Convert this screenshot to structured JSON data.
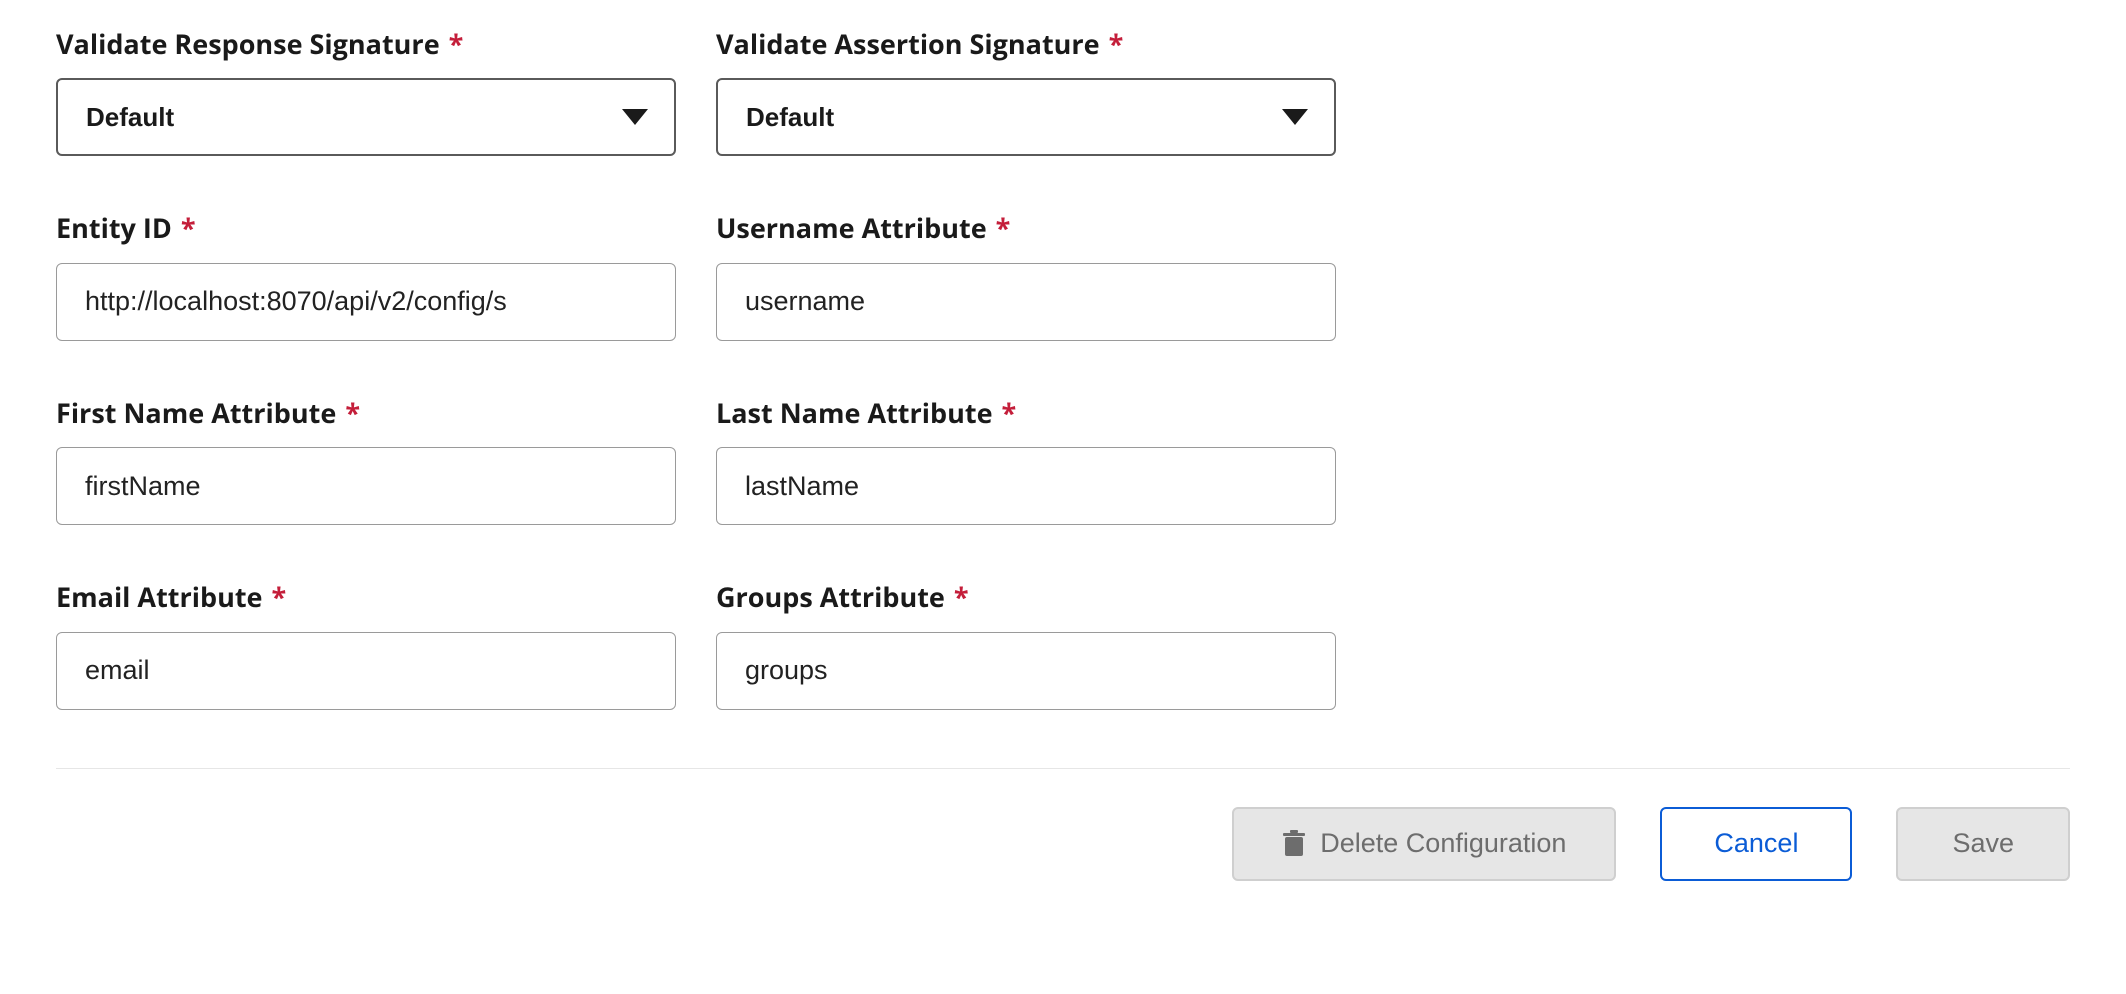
{
  "form": {
    "validate_response_signature": {
      "label": "Validate Response Signature",
      "value": "Default"
    },
    "validate_assertion_signature": {
      "label": "Validate Assertion Signature",
      "value": "Default"
    },
    "entity_id": {
      "label": "Entity ID",
      "value": "http://localhost:8070/api/v2/config/s"
    },
    "username_attribute": {
      "label": "Username Attribute",
      "value": "username"
    },
    "first_name_attribute": {
      "label": "First Name Attribute",
      "value": "firstName"
    },
    "last_name_attribute": {
      "label": "Last Name Attribute",
      "value": "lastName"
    },
    "email_attribute": {
      "label": "Email Attribute",
      "value": "email"
    },
    "groups_attribute": {
      "label": "Groups Attribute",
      "value": "groups"
    }
  },
  "buttons": {
    "delete": "Delete Configuration",
    "cancel": "Cancel",
    "save": "Save"
  },
  "required_marker": "*"
}
